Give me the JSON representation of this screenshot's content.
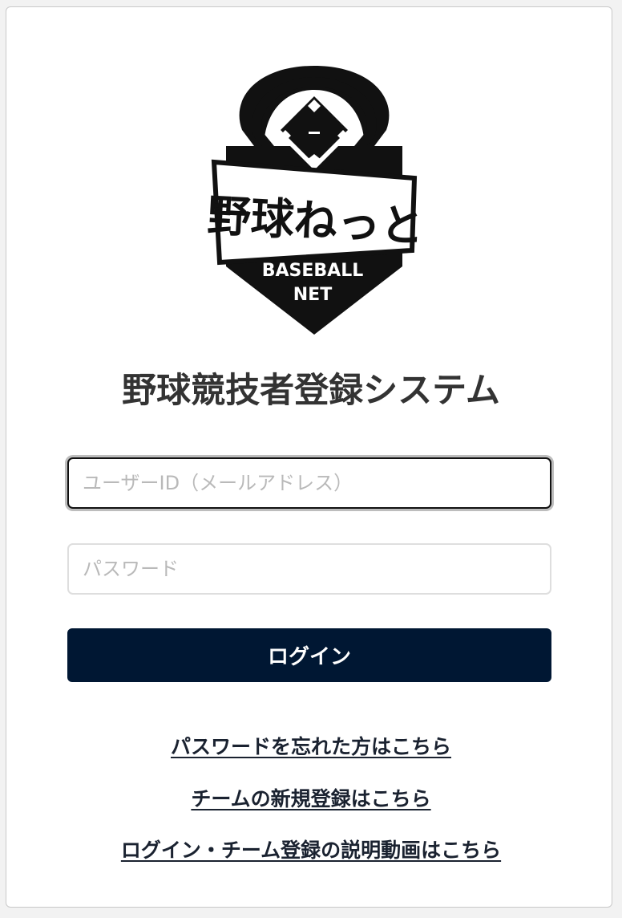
{
  "logo": {
    "icon": "baseball-diamond-icon",
    "brand_jp": "野球ねっと",
    "brand_en_line1": "BASEBALL",
    "brand_en_line2": "NET",
    "colors": {
      "primary": "#111111",
      "background": "#ffffff"
    }
  },
  "page_title": "野球競技者登録システム",
  "form": {
    "user_id": {
      "value": "",
      "placeholder": "ユーザーID（メールアドレス）"
    },
    "password": {
      "value": "",
      "placeholder": "パスワード"
    },
    "login_label": "ログイン"
  },
  "links": {
    "forgot_password": "パスワードを忘れた方はこちら",
    "new_team": "チームの新規登録はこちら",
    "tutorial_video": "ログイン・チーム登録の説明動画はこちら"
  },
  "colors": {
    "button_bg": "#001733",
    "button_text": "#ffffff",
    "title_text": "#333333",
    "link_text": "#1a2230"
  }
}
